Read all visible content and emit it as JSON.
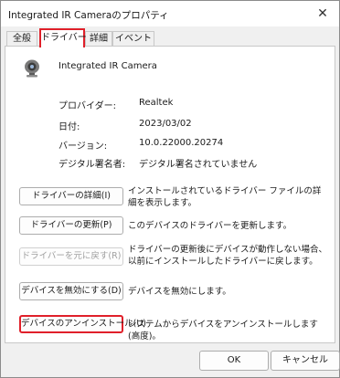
{
  "window": {
    "title": "Integrated IR Cameraのプロパティ",
    "close_label": "✕"
  },
  "tabs": [
    {
      "label": "全般"
    },
    {
      "label": "ドライバー",
      "active": true
    },
    {
      "label": "詳細"
    },
    {
      "label": "イベント"
    }
  ],
  "device": {
    "name": "Integrated IR Camera",
    "icon": "webcam-icon"
  },
  "properties": [
    {
      "label": "プロバイダー:",
      "value": "Realtek"
    },
    {
      "label": "日付:",
      "value": "2023/03/02"
    },
    {
      "label": "バージョン:",
      "value": "10.0.22000.20274"
    },
    {
      "label": "デジタル署名者:",
      "value": "デジタル署名されていません"
    }
  ],
  "actions": [
    {
      "label": "ドライバーの詳細(I)",
      "desc": "インストールされているドライバー ファイルの詳細を表示します。",
      "enabled": true
    },
    {
      "label": "ドライバーの更新(P)",
      "desc": "このデバイスのドライバーを更新します。",
      "enabled": true
    },
    {
      "label": "ドライバーを元に戻す(R)",
      "desc": "ドライバーの更新後にデバイスが動作しない場合、以前にインストールしたドライバーに戻します。",
      "enabled": false
    },
    {
      "label": "デバイスを無効にする(D)",
      "desc": "デバイスを無効にします。",
      "enabled": true
    },
    {
      "label": "デバイスのアンインストール(U)",
      "desc": "システムからデバイスをアンインストールします (高度)。",
      "enabled": true
    }
  ],
  "footer": {
    "ok_label": "OK",
    "cancel_label": "キャンセル"
  },
  "colors": {
    "highlight": "#e0202a"
  }
}
